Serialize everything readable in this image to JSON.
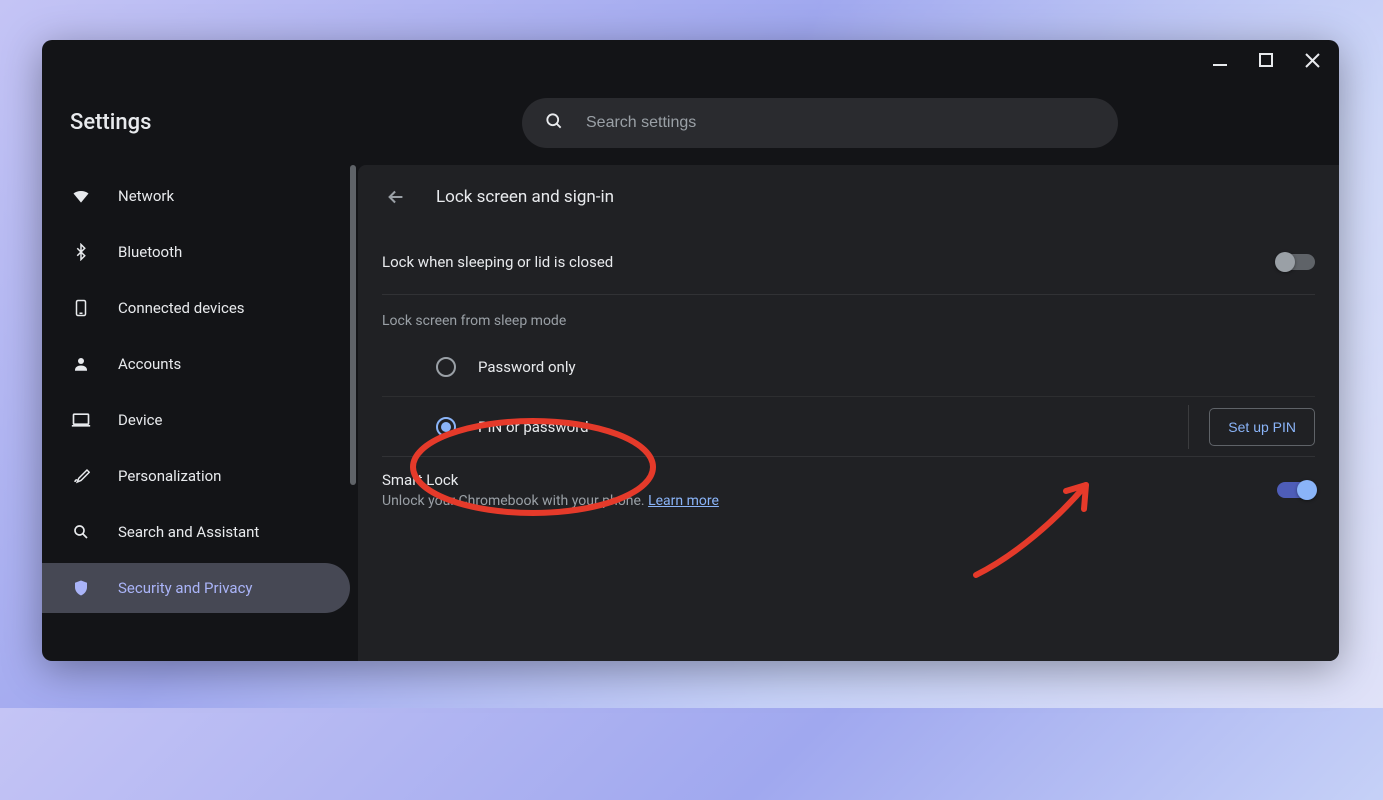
{
  "app_title": "Settings",
  "search": {
    "placeholder": "Search settings"
  },
  "sidebar": {
    "items": [
      {
        "label": "Network",
        "icon": "wifi-icon"
      },
      {
        "label": "Bluetooth",
        "icon": "bluetooth-icon"
      },
      {
        "label": "Connected devices",
        "icon": "phone-icon"
      },
      {
        "label": "Accounts",
        "icon": "person-icon"
      },
      {
        "label": "Device",
        "icon": "laptop-icon"
      },
      {
        "label": "Personalization",
        "icon": "brush-icon"
      },
      {
        "label": "Search and Assistant",
        "icon": "search-icon"
      },
      {
        "label": "Security and Privacy",
        "icon": "shield-icon"
      }
    ],
    "active_index": 7
  },
  "page": {
    "title": "Lock screen and sign-in",
    "lock_sleep_label": "Lock when sleeping or lid is closed",
    "lock_sleep_on": false,
    "section_label": "Lock screen from sleep mode",
    "radio_password_label": "Password only",
    "radio_pin_label": "PIN or password",
    "radio_selected": "pin",
    "setup_pin_label": "Set up PIN",
    "smart_title": "Smart Lock",
    "smart_sub_prefix": "Unlock your Chromebook with your phone. ",
    "smart_learn_more": "Learn more",
    "smart_on": true
  }
}
